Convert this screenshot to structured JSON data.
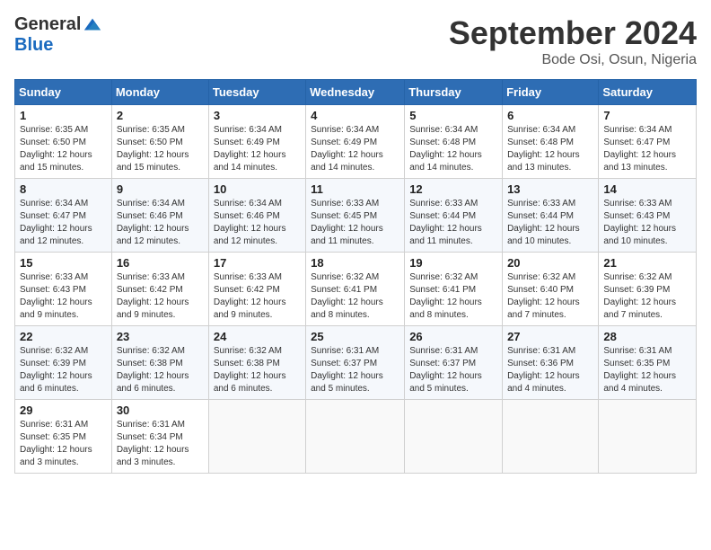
{
  "header": {
    "logo_general": "General",
    "logo_blue": "Blue",
    "month_title": "September 2024",
    "location": "Bode Osi, Osun, Nigeria"
  },
  "days_of_week": [
    "Sunday",
    "Monday",
    "Tuesday",
    "Wednesday",
    "Thursday",
    "Friday",
    "Saturday"
  ],
  "weeks": [
    [
      {
        "day": "1",
        "sunrise": "6:35 AM",
        "sunset": "6:50 PM",
        "daylight": "12 hours and 15 minutes."
      },
      {
        "day": "2",
        "sunrise": "6:35 AM",
        "sunset": "6:50 PM",
        "daylight": "12 hours and 15 minutes."
      },
      {
        "day": "3",
        "sunrise": "6:34 AM",
        "sunset": "6:49 PM",
        "daylight": "12 hours and 14 minutes."
      },
      {
        "day": "4",
        "sunrise": "6:34 AM",
        "sunset": "6:49 PM",
        "daylight": "12 hours and 14 minutes."
      },
      {
        "day": "5",
        "sunrise": "6:34 AM",
        "sunset": "6:48 PM",
        "daylight": "12 hours and 14 minutes."
      },
      {
        "day": "6",
        "sunrise": "6:34 AM",
        "sunset": "6:48 PM",
        "daylight": "12 hours and 13 minutes."
      },
      {
        "day": "7",
        "sunrise": "6:34 AM",
        "sunset": "6:47 PM",
        "daylight": "12 hours and 13 minutes."
      }
    ],
    [
      {
        "day": "8",
        "sunrise": "6:34 AM",
        "sunset": "6:47 PM",
        "daylight": "12 hours and 12 minutes."
      },
      {
        "day": "9",
        "sunrise": "6:34 AM",
        "sunset": "6:46 PM",
        "daylight": "12 hours and 12 minutes."
      },
      {
        "day": "10",
        "sunrise": "6:34 AM",
        "sunset": "6:46 PM",
        "daylight": "12 hours and 12 minutes."
      },
      {
        "day": "11",
        "sunrise": "6:33 AM",
        "sunset": "6:45 PM",
        "daylight": "12 hours and 11 minutes."
      },
      {
        "day": "12",
        "sunrise": "6:33 AM",
        "sunset": "6:44 PM",
        "daylight": "12 hours and 11 minutes."
      },
      {
        "day": "13",
        "sunrise": "6:33 AM",
        "sunset": "6:44 PM",
        "daylight": "12 hours and 10 minutes."
      },
      {
        "day": "14",
        "sunrise": "6:33 AM",
        "sunset": "6:43 PM",
        "daylight": "12 hours and 10 minutes."
      }
    ],
    [
      {
        "day": "15",
        "sunrise": "6:33 AM",
        "sunset": "6:43 PM",
        "daylight": "12 hours and 9 minutes."
      },
      {
        "day": "16",
        "sunrise": "6:33 AM",
        "sunset": "6:42 PM",
        "daylight": "12 hours and 9 minutes."
      },
      {
        "day": "17",
        "sunrise": "6:33 AM",
        "sunset": "6:42 PM",
        "daylight": "12 hours and 9 minutes."
      },
      {
        "day": "18",
        "sunrise": "6:32 AM",
        "sunset": "6:41 PM",
        "daylight": "12 hours and 8 minutes."
      },
      {
        "day": "19",
        "sunrise": "6:32 AM",
        "sunset": "6:41 PM",
        "daylight": "12 hours and 8 minutes."
      },
      {
        "day": "20",
        "sunrise": "6:32 AM",
        "sunset": "6:40 PM",
        "daylight": "12 hours and 7 minutes."
      },
      {
        "day": "21",
        "sunrise": "6:32 AM",
        "sunset": "6:39 PM",
        "daylight": "12 hours and 7 minutes."
      }
    ],
    [
      {
        "day": "22",
        "sunrise": "6:32 AM",
        "sunset": "6:39 PM",
        "daylight": "12 hours and 6 minutes."
      },
      {
        "day": "23",
        "sunrise": "6:32 AM",
        "sunset": "6:38 PM",
        "daylight": "12 hours and 6 minutes."
      },
      {
        "day": "24",
        "sunrise": "6:32 AM",
        "sunset": "6:38 PM",
        "daylight": "12 hours and 6 minutes."
      },
      {
        "day": "25",
        "sunrise": "6:31 AM",
        "sunset": "6:37 PM",
        "daylight": "12 hours and 5 minutes."
      },
      {
        "day": "26",
        "sunrise": "6:31 AM",
        "sunset": "6:37 PM",
        "daylight": "12 hours and 5 minutes."
      },
      {
        "day": "27",
        "sunrise": "6:31 AM",
        "sunset": "6:36 PM",
        "daylight": "12 hours and 4 minutes."
      },
      {
        "day": "28",
        "sunrise": "6:31 AM",
        "sunset": "6:35 PM",
        "daylight": "12 hours and 4 minutes."
      }
    ],
    [
      {
        "day": "29",
        "sunrise": "6:31 AM",
        "sunset": "6:35 PM",
        "daylight": "12 hours and 3 minutes."
      },
      {
        "day": "30",
        "sunrise": "6:31 AM",
        "sunset": "6:34 PM",
        "daylight": "12 hours and 3 minutes."
      },
      null,
      null,
      null,
      null,
      null
    ]
  ]
}
